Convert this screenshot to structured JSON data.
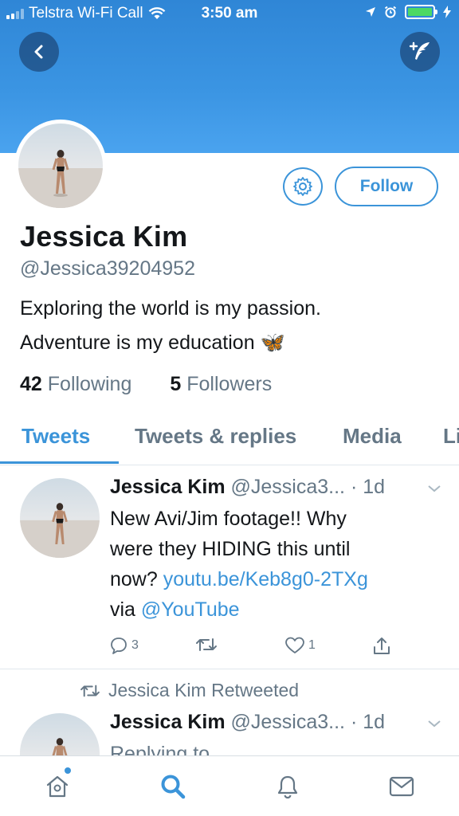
{
  "status_bar": {
    "carrier": "Telstra Wi-Fi Call",
    "time": "3:50 am",
    "battery_level": 1.0
  },
  "header": {
    "back_icon": "chevron-left-icon",
    "compose_icon": "compose-tweet-icon"
  },
  "profile": {
    "name": "Jessica Kim",
    "handle": "@Jessica39204952",
    "bio_line1": "Exploring the world is my passion.",
    "bio_line2": "Adventure is my education 🦋",
    "following_count": "42",
    "following_label": "Following",
    "followers_count": "5",
    "followers_label": "Followers",
    "follow_button": "Follow",
    "settings_icon": "gear-icon"
  },
  "tabs": [
    {
      "label": "Tweets",
      "active": true
    },
    {
      "label": "Tweets & replies",
      "active": false
    },
    {
      "label": "Media",
      "active": false
    },
    {
      "label": "Li",
      "active": false
    }
  ],
  "tweets": [
    {
      "name": "Jessica Kim",
      "handle": "@Jessica3...",
      "time": "· 1d",
      "text_line1": "New Avi/Jim footage!! Why",
      "text_line2": "were they HIDING this until",
      "text_line3_prefix": "now? ",
      "link": "youtu.be/Keb8g0-2TXg",
      "text_line4_prefix": "via ",
      "mention": "@YouTube",
      "reply_count": "3",
      "like_count": "1"
    },
    {
      "retweeted_label": "Jessica Kim Retweeted",
      "name": "Jessica Kim",
      "handle": "@Jessica3...",
      "time": "· 1d",
      "partial_text": "Replying to"
    }
  ],
  "tab_bar": [
    "home-icon",
    "search-icon",
    "notifications-icon",
    "messages-icon"
  ],
  "colors": {
    "accent": "#3b94d9",
    "banner": "#3b95e3",
    "secondary_text": "#657786"
  }
}
